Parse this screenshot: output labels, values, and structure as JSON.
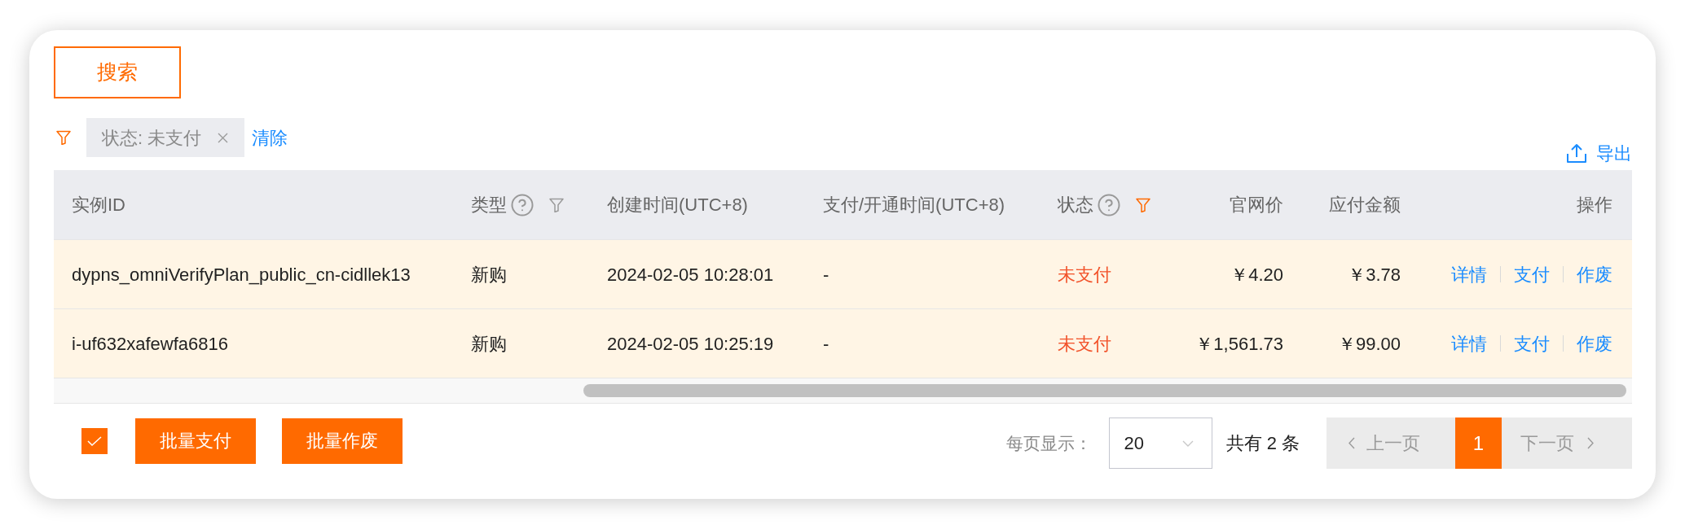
{
  "search": {
    "label": "搜索"
  },
  "filter_bar": {
    "tags": [
      {
        "label": "状态: 未支付"
      }
    ],
    "clear": "清除"
  },
  "export": {
    "label": "导出"
  },
  "table": {
    "columns": [
      {
        "label": "实例ID",
        "kind": "text",
        "help": false,
        "filter": false
      },
      {
        "label": "类型",
        "kind": "text",
        "help": true,
        "filter": true,
        "filter_active": false
      },
      {
        "label": "创建时间(UTC+8)",
        "kind": "text",
        "help": false,
        "filter": false
      },
      {
        "label": "支付/开通时间(UTC+8)",
        "kind": "text",
        "help": false,
        "filter": false
      },
      {
        "label": "状态",
        "kind": "status",
        "help": true,
        "filter": true,
        "filter_active": true
      },
      {
        "label": "官网价",
        "kind": "money",
        "help": false,
        "filter": false
      },
      {
        "label": "应付金额",
        "kind": "money",
        "help": false,
        "filter": false
      },
      {
        "label": "操作",
        "kind": "actions",
        "help": false,
        "filter": false
      }
    ],
    "rows": [
      {
        "selected": true,
        "cells": [
          "dypns_omniVerifyPlan_public_cn-cidllek13",
          "新购",
          "2024-02-05 10:28:01",
          "-",
          "未支付",
          "￥4.20",
          "￥3.78"
        ],
        "actions": [
          "详情",
          "支付",
          "作废"
        ]
      },
      {
        "selected": true,
        "cells": [
          "i-uf632xafewfa6816",
          "新购",
          "2024-02-05 10:25:19",
          "-",
          "未支付",
          "￥1,561.73",
          "￥99.00"
        ],
        "actions": [
          "详情",
          "支付",
          "作废"
        ]
      }
    ]
  },
  "footer": {
    "select_all": {
      "checked": true
    },
    "bulk_actions": [
      "批量支付",
      "批量作废"
    ],
    "page_size": {
      "label": "每页显示：",
      "value": "20"
    },
    "total": "共有 2 条",
    "pagination": {
      "prev": {
        "label": "上一页",
        "disabled": true
      },
      "pages": [
        {
          "label": "1",
          "selected": true
        }
      ],
      "next": {
        "label": "下一页",
        "disabled": true
      }
    }
  }
}
